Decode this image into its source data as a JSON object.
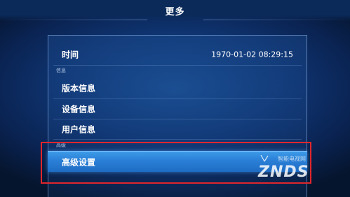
{
  "header": {
    "title": "更多"
  },
  "time_row": {
    "label": "时间",
    "value": "1970-01-02 08:29:15"
  },
  "info_section": {
    "header": "信息",
    "items": [
      {
        "label": "版本信息"
      },
      {
        "label": "设备信息"
      },
      {
        "label": "用户信息"
      }
    ]
  },
  "advanced_section": {
    "header": "高级",
    "items": [
      {
        "label": "高级设置",
        "selected": true
      }
    ]
  },
  "watermark": {
    "brand": "ZNDS",
    "subtitle": "智能电视网"
  },
  "colors": {
    "selected_bar": "#2a7fd6",
    "highlight_box": "#e0262b",
    "background": "#0f3572"
  }
}
